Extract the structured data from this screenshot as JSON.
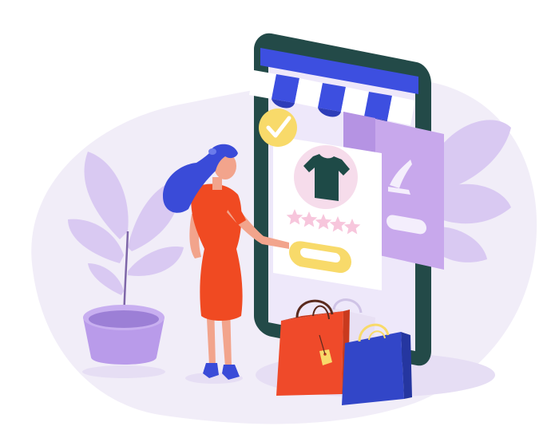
{
  "illustration": {
    "subject": "online-shopping",
    "rating": {
      "stars_filled": 5,
      "stars_total": 5
    },
    "colors": {
      "backdrop": "#F1EDF8",
      "phone_frame": "#234A48",
      "screen": "#EEE8FA",
      "awning_blue": "#3D4FE0",
      "awning_white": "#FFFFFF",
      "product_card": "#FFFFFF",
      "shirt": "#1E4A47",
      "shirt_circle": "#F6DCEB",
      "star": "#F7C6DC",
      "button_yellow": "#F8DA6A",
      "check_badge": "#F8DA6A",
      "side_panel": "#C8A8EC",
      "plant_leaf": "#D9C9F2",
      "pot": "#B99BEA",
      "dress": "#F04A22",
      "hair": "#3A4BD8",
      "skin": "#F2A48C",
      "bag_red": "#EF4A2A",
      "bag_blue": "#3246C8",
      "tag_yellow": "#F8DA6A"
    },
    "icons": [
      "check-icon",
      "tshirt-icon",
      "star-icon",
      "high-heel-icon",
      "shopping-bag-icon",
      "plant-icon"
    ]
  }
}
